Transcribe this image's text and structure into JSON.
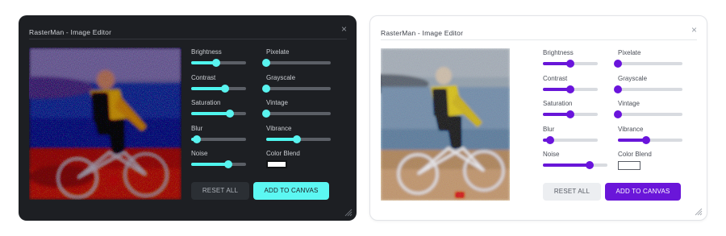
{
  "editors": [
    {
      "theme": "dark",
      "title": "RasterMan - Image Editor",
      "close_icon": "×",
      "accent": "#4ff5ee",
      "controls": [
        {
          "label": "Brightness",
          "value": 0.45
        },
        {
          "label": "Pixelate",
          "value": 0.0
        },
        {
          "label": "Contrast",
          "value": 0.62
        },
        {
          "label": "Grayscale",
          "value": 0.0
        },
        {
          "label": "Saturation",
          "value": 0.7
        },
        {
          "label": "Vintage",
          "value": 0.0
        },
        {
          "label": "Blur",
          "value": 0.1
        },
        {
          "label": "Vibrance",
          "value": 0.48
        },
        {
          "label": "Noise",
          "value": 0.68
        }
      ],
      "color_blend_label": "Color Blend",
      "color_blend_value": "#ffffff",
      "reset_label": "RESET ALL",
      "add_label": "ADD TO CANVAS"
    },
    {
      "theme": "light",
      "title": "RasterMan - Image Editor",
      "close_icon": "×",
      "accent": "#6816d8",
      "controls": [
        {
          "label": "Brightness",
          "value": 0.5
        },
        {
          "label": "Pixelate",
          "value": 0.0
        },
        {
          "label": "Contrast",
          "value": 0.5
        },
        {
          "label": "Grayscale",
          "value": 0.0
        },
        {
          "label": "Saturation",
          "value": 0.5
        },
        {
          "label": "Vintage",
          "value": 0.0
        },
        {
          "label": "Blur",
          "value": 0.13
        },
        {
          "label": "Vibrance",
          "value": 0.44
        },
        {
          "label": "Noise",
          "value": 0.73
        }
      ],
      "color_blend_label": "Color Blend",
      "color_blend_value": "#ffffff",
      "reset_label": "RESET ALL",
      "add_label": "ADD TO CANVAS"
    }
  ]
}
